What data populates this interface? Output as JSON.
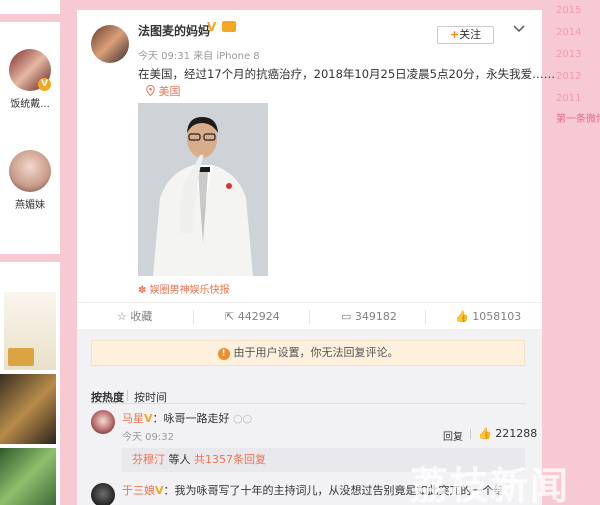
{
  "left": {
    "users": [
      {
        "name": "饭统戴..."
      },
      {
        "name": "燕媚妹"
      }
    ]
  },
  "timeline": {
    "years": [
      "2015",
      "2014",
      "2013",
      "2012",
      "2011"
    ],
    "more": "第一条微博"
  },
  "post": {
    "username": "法图麦的妈妈",
    "verified": "V",
    "time": "今天 09:31",
    "source": "来自 iPhone 8",
    "follow_label": "关注",
    "text": "在美国，经过17个月的抗癌治疗，2018年10月25日凌晨5点20分，永失我爱……",
    "location": "美国",
    "watermark": "娱圈男神娱乐快报"
  },
  "actions": {
    "collect": "收藏",
    "forward": "442924",
    "comment": "349182",
    "like": "1058103"
  },
  "comments": {
    "notice": "由于用户设置，你无法回复评论。",
    "sort_hot": "按热度",
    "sort_time": "按时间",
    "items": [
      {
        "user": "马星",
        "verified": "V",
        "text": "：咏哥一路走好",
        "time": "今天 09:32",
        "reply": "回复",
        "likes": "221288",
        "subreply_user": "芬穆汀",
        "subreply_text": "等人",
        "subreply_count": "共1357条回复"
      },
      {
        "user": "于三娘",
        "verified": "V",
        "text": "：我为咏哥写了十年的主持词儿，从没想过告别竟是如此突兀的一个结尾……"
      }
    ]
  },
  "watermark_big": "荔枝新闻",
  "colors": {
    "background": "#f7c9d3",
    "accent": "#eb7350",
    "verified": "#f5a623"
  }
}
